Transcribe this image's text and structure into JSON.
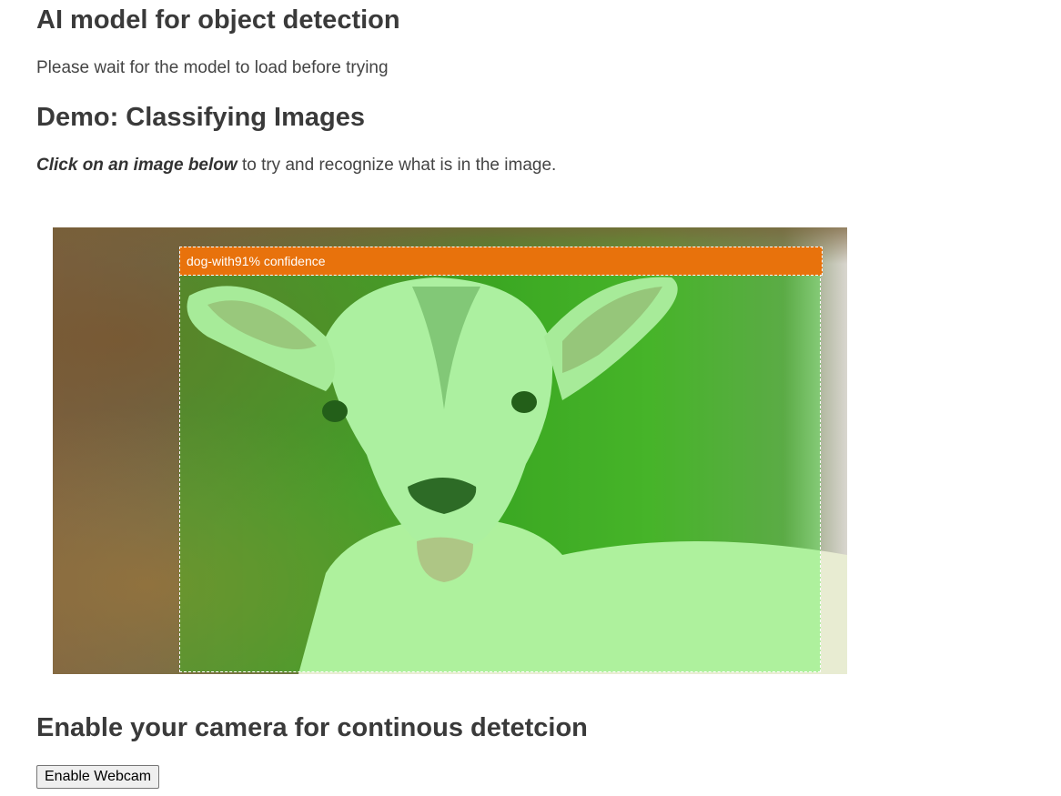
{
  "page": {
    "title": "AI model for object detection",
    "load_note": "Please wait for the model to load before trying"
  },
  "demo": {
    "title": "Demo: Classifying Images",
    "instruction_emphasis": "Click on an image below",
    "instruction_rest": " to try and recognize what is in the image.",
    "image_subject": "goat kid sticking out tongue",
    "detection": {
      "label": "dog-with91% confidence",
      "class": "dog",
      "confidence_percent": 91,
      "label_color": "#e8720c",
      "highlight_color": "rgba(0,255,0,0.25)"
    }
  },
  "camera": {
    "title": "Enable your camera for continous detetcion",
    "button_label": "Enable Webcam"
  }
}
